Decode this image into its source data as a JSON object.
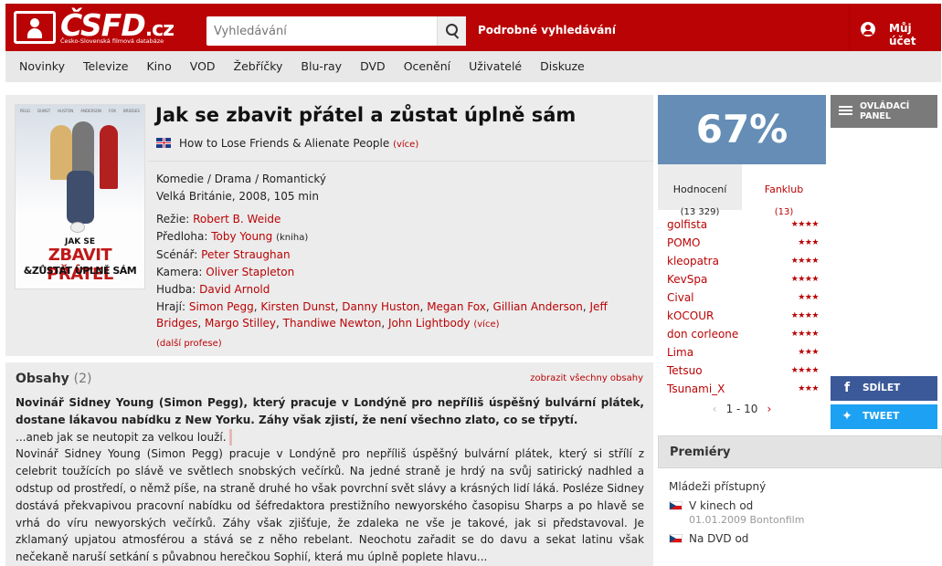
{
  "header": {
    "logo_text": "ČSFD",
    "logo_suffix": ".cz",
    "logo_tagline": "Česko-Slovenská filmová databáze",
    "search_placeholder": "Vyhledávání",
    "advanced_search": "Podrobné vyhledávání",
    "account": "Můj účet"
  },
  "nav": {
    "items": [
      "Novinky",
      "Televize",
      "Kino",
      "VOD",
      "Žebříčky",
      "Blu-ray",
      "DVD",
      "Ocenění",
      "Uživatelé",
      "Diskuze"
    ]
  },
  "film": {
    "title": "Jak se zbavit přátel a zůstat úplně sám",
    "original_title": "How to Lose Friends & Alienate People",
    "original_more": "(více)",
    "genres": "Komedie / Drama / Romantický",
    "origin": "Velká Británie, 2008, 105 min",
    "poster": {
      "cast_names": [
        "PEGG",
        "DUNST",
        "HUSTON",
        "ANDERSON",
        "FOX",
        "BRIDGES"
      ],
      "line1": "JAK SE",
      "line2": "ZBAVIT PŘÁTEL",
      "line3": "&ZŮSTAT ÚPLNĚ SÁM"
    },
    "credits": {
      "director_label": "Režie:",
      "director": "Robert B. Weide",
      "source_label": "Předloha:",
      "source": "Toby Young",
      "source_note": "(kniha)",
      "writer_label": "Scénář:",
      "writer": "Peter Straughan",
      "camera_label": "Kamera:",
      "camera": "Oliver Stapleton",
      "music_label": "Hudba:",
      "music": "David Arnold",
      "cast_label": "Hrají:",
      "cast": [
        "Simon Pegg",
        "Kirsten Dunst",
        "Danny Huston",
        "Megan Fox",
        "Gillian Anderson",
        "Jeff Bridges",
        "Margo Stilley",
        "Thandiwe Newton",
        "John Lightbody"
      ],
      "cast_more": "(více)",
      "more_professions": "(další profese)"
    }
  },
  "synopsis": {
    "title": "Obsahy",
    "count": "(2)",
    "show_all": "zobrazit všechny obsahy",
    "lead": "Novinář Sidney Young (Simon Pegg), který pracuje v Londýně pro nepříliš úspěšný bulvární plátek, dostane lákavou nabídku z New Yorku. Záhy však zjistí, že není všechno zlato, co se třpytí.",
    "tagline": "...aneb jak se neutopit za velkou louží.",
    "text": "Novinář Sidney Young (Simon Pegg) pracuje v Londýně pro nepříliš úspěšný bulvární plátek, který si střílí z celebrit toužících po slávě ve světlech snobských večírků. Na jedné straně je hrdý na svůj satirický nadhled a odstup od prostředí, o němž píše, na straně druhé ho však povrchní svět slávy a krásných lidí láká. Posléze Sidney dostává překvapivou pracovní nabídku od šéfredaktora prestižního newyorského časopisu Sharps a po hlavě se vrhá do víru newyorských večírků. Záhy však zjišťuje, že zdaleka ne vše je takové, jak si představoval. Je zklamaný upjatou atmosférou a stává se z něho rebelant. Neochotu zařadit se do davu a sekat latinu však nečekaně naruší setkání s půvabnou herečkou Sophií, která mu úplně poplete hlavu..."
  },
  "rating": {
    "score": "67%",
    "tab_ratings": "Hodnocení",
    "tab_ratings_count": "(13 329)",
    "tab_fanclub": "Fanklub",
    "tab_fanclub_count": "(13)",
    "users": [
      {
        "name": "golfista",
        "stars": "★★★★"
      },
      {
        "name": "POMO",
        "stars": "★★★"
      },
      {
        "name": "kleopatra",
        "stars": "★★★★"
      },
      {
        "name": "KevSpa",
        "stars": "★★★★"
      },
      {
        "name": "Cival",
        "stars": "★★★"
      },
      {
        "name": "kOCOUR",
        "stars": "★★★★"
      },
      {
        "name": "don corleone",
        "stars": "★★★★"
      },
      {
        "name": "Lima",
        "stars": "★★★"
      },
      {
        "name": "Tetsuo",
        "stars": "★★★★"
      },
      {
        "name": "Tsunami_X",
        "stars": "★★★"
      }
    ],
    "pager": "1 - 10"
  },
  "side": {
    "panel_button": "OVLÁDACÍ PANEL",
    "share_fb": "SDÍLET",
    "share_tw": "TWEET"
  },
  "premieres": {
    "title": "Premiéry",
    "age": "Mládeži přístupný",
    "cinema_label": "V kinech od",
    "cinema_date": "01.01.2009 Bontonfilm",
    "dvd_label": "Na DVD od"
  },
  "colors": {
    "brand": "#ba0305",
    "score_bg": "#658db5",
    "facebook": "#3b5998",
    "twitter": "#1da1f2"
  }
}
